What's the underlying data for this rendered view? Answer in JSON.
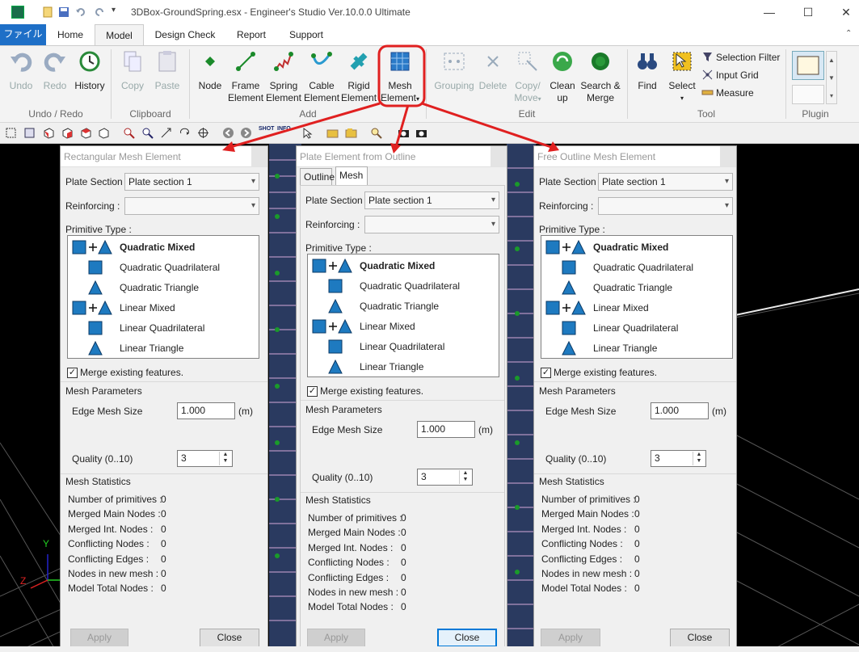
{
  "window": {
    "title": "3DBox-GroundSpring.esx - Engineer's Studio Ver.10.0.0 Ultimate"
  },
  "menu": {
    "file": "ファイル",
    "tabs": [
      "Home",
      "Model",
      "Design Check",
      "Report",
      "Support"
    ],
    "active_tab": "Model"
  },
  "ribbon": {
    "undo_group": {
      "label": "Undo / Redo",
      "undo": "Undo",
      "redo": "Redo",
      "history": "History"
    },
    "clipboard_group": {
      "label": "Clipboard",
      "copy": "Copy",
      "paste": "Paste"
    },
    "add_group": {
      "label": "Add",
      "node": "Node",
      "frame": [
        "Frame",
        "Element"
      ],
      "spring": [
        "Spring",
        "Element"
      ],
      "cable": [
        "Cable",
        "Element"
      ],
      "rigid": [
        "Rigid",
        "Element"
      ],
      "mesh": [
        "Mesh",
        "Element"
      ]
    },
    "edit_group": {
      "label": "Edit",
      "grouping": "Grouping",
      "delete": "Delete",
      "copy_move": [
        "Copy/",
        "Move"
      ],
      "cleanup": [
        "Clean",
        "up"
      ],
      "search_merge": [
        "Search &",
        "Merge"
      ]
    },
    "tool_group": {
      "label": "Tool",
      "find": "Find",
      "select": "Select",
      "selection_filter": "Selection Filter",
      "input_grid": "Input Grid",
      "measure": "Measure"
    },
    "plugin_group": {
      "label": "Plugin"
    }
  },
  "dialogs": {
    "rect": {
      "title": "Rectangular Mesh Element",
      "plate_section_label": "Plate Section :",
      "plate_section_value": "Plate section 1",
      "reinforcing_label": "Reinforcing :",
      "reinforcing_value": "",
      "primitive_type_label": "Primitive Type :",
      "primitives": [
        "Quadratic Mixed",
        "Quadratic Quadrilateral",
        "Quadratic Triangle",
        "Linear Mixed",
        "Linear Quadrilateral",
        "Linear Triangle"
      ],
      "merge_label": "Merge existing features.",
      "merge_checked": true,
      "mesh_params_label": "Mesh Parameters",
      "edge_mesh_label": "Edge Mesh Size",
      "edge_mesh_value": "1.000",
      "edge_mesh_unit": "(m)",
      "quality_label": "Quality  (0..10)",
      "quality_value": "3",
      "stats_label": "Mesh Statistics",
      "stats": [
        {
          "label": "Number of primitives :",
          "value": "0"
        },
        {
          "label": "Merged Main Nodes :",
          "value": "0"
        },
        {
          "label": "Merged Int. Nodes :",
          "value": "0"
        },
        {
          "label": "Conflicting Nodes :",
          "value": "0"
        },
        {
          "label": "Conflicting Edges :",
          "value": "0"
        },
        {
          "label": "Nodes in new mesh :",
          "value": "0"
        },
        {
          "label": "Model Total Nodes :",
          "value": "0"
        }
      ],
      "apply": "Apply",
      "close": "Close"
    },
    "plate": {
      "title": "Plate Element from Outline",
      "tabs": [
        "Outline",
        "Mesh"
      ],
      "active_tab": "Mesh",
      "plate_section_label": "Plate Section :",
      "plate_section_value": "Plate section 1",
      "reinforcing_label": "Reinforcing :",
      "reinforcing_value": "",
      "primitive_type_label": "Primitive Type :",
      "primitives": [
        "Quadratic Mixed",
        "Quadratic Quadrilateral",
        "Quadratic Triangle",
        "Linear Mixed",
        "Linear Quadrilateral",
        "Linear Triangle"
      ],
      "merge_label": "Merge existing features.",
      "merge_checked": true,
      "mesh_params_label": "Mesh Parameters",
      "edge_mesh_label": "Edge Mesh Size",
      "edge_mesh_value": "1.000",
      "edge_mesh_unit": "(m)",
      "quality_label": "Quality  (0..10)",
      "quality_value": "3",
      "stats_label": "Mesh Statistics",
      "stats": [
        {
          "label": "Number of primitives :",
          "value": "0"
        },
        {
          "label": "Merged Main Nodes :",
          "value": "0"
        },
        {
          "label": "Merged Int. Nodes :",
          "value": "0"
        },
        {
          "label": "Conflicting Nodes :",
          "value": "0"
        },
        {
          "label": "Conflicting Edges :",
          "value": "0"
        },
        {
          "label": "Nodes in new mesh :",
          "value": "0"
        },
        {
          "label": "Model Total Nodes :",
          "value": "0"
        }
      ],
      "apply": "Apply",
      "close": "Close"
    },
    "free": {
      "title": "Free Outline Mesh Element",
      "plate_section_label": "Plate Section :",
      "plate_section_value": "Plate section 1",
      "reinforcing_label": "Reinforcing :",
      "reinforcing_value": "",
      "primitive_type_label": "Primitive Type :",
      "primitives": [
        "Quadratic Mixed",
        "Quadratic Quadrilateral",
        "Quadratic Triangle",
        "Linear Mixed",
        "Linear Quadrilateral",
        "Linear Triangle"
      ],
      "merge_label": "Merge existing features.",
      "merge_checked": true,
      "mesh_params_label": "Mesh Parameters",
      "edge_mesh_label": "Edge Mesh Size",
      "edge_mesh_value": "1.000",
      "edge_mesh_unit": "(m)",
      "quality_label": "Quality  (0..10)",
      "quality_value": "3",
      "stats_label": "Mesh Statistics",
      "stats": [
        {
          "label": "Number of primitives :",
          "value": "0"
        },
        {
          "label": "Merged Main Nodes :",
          "value": "0"
        },
        {
          "label": "Merged Int. Nodes :",
          "value": "0"
        },
        {
          "label": "Conflicting Nodes :",
          "value": "0"
        },
        {
          "label": "Conflicting Edges :",
          "value": "0"
        },
        {
          "label": "Nodes in new mesh :",
          "value": "0"
        },
        {
          "label": "Model Total Nodes :",
          "value": "0"
        }
      ],
      "apply": "Apply",
      "close": "Close"
    }
  },
  "axes": {
    "y": "Y",
    "z": "Z"
  },
  "colors": {
    "accent": "#1e6fc7",
    "annotation": "#e02020",
    "primitive_fill": "#1e7ac0",
    "viewport": "#000000"
  }
}
